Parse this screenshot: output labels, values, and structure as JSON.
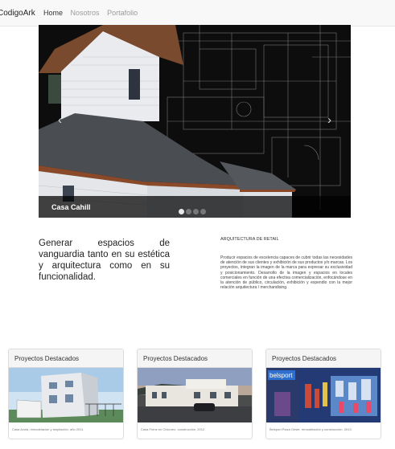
{
  "navbar": {
    "brand": "CodigoArk",
    "links": [
      {
        "label": "Home",
        "active": true
      },
      {
        "label": "Nosotros",
        "active": false
      },
      {
        "label": "Portafolio",
        "active": false
      }
    ]
  },
  "carousel": {
    "caption": "Casa Cahill",
    "slide_count": 4,
    "active_slide": 1,
    "prev_icon": "chevron-left-icon",
    "next_icon": "chevron-right-icon"
  },
  "intro": {
    "tagline": "Generar espacios de vanguardia tanto en su estética y arquitectura como en su funcionalidad.",
    "section_title": "ARQUITECTURA DE RETAIL",
    "section_text": "Producir espacios de excelencia capaces de cubrir todas las necesidades de atención de sus clientes y exhibición de sus productos y/o marcas. Los proyectos, integran la imagen de la marca para expresar su exclusividad y posicionamiento. Desarrollo de la imagen y espacios en locales comerciales en función de una efectiva comercialización, enfocándose en la atención de público, circulación, exhibición y expendio con la mejor relación arquitectura / merchandising."
  },
  "cards": [
    {
      "title": "Proyectos Destacados",
      "caption": "Casa Avola, remodelación y ampliación, año 2011."
    },
    {
      "title": "Proyectos Destacados",
      "caption": "Casa Frenz en Chicureo, construcción, 2012."
    },
    {
      "title": "Proyectos Destacados",
      "caption": "Belsport Plaza Oeste, remodelación y construcción, 2013."
    }
  ],
  "card3_sign": "belsport",
  "colors": {
    "navbar_bg": "#f8f8f8",
    "card_head_bg": "#f5f5f5"
  }
}
